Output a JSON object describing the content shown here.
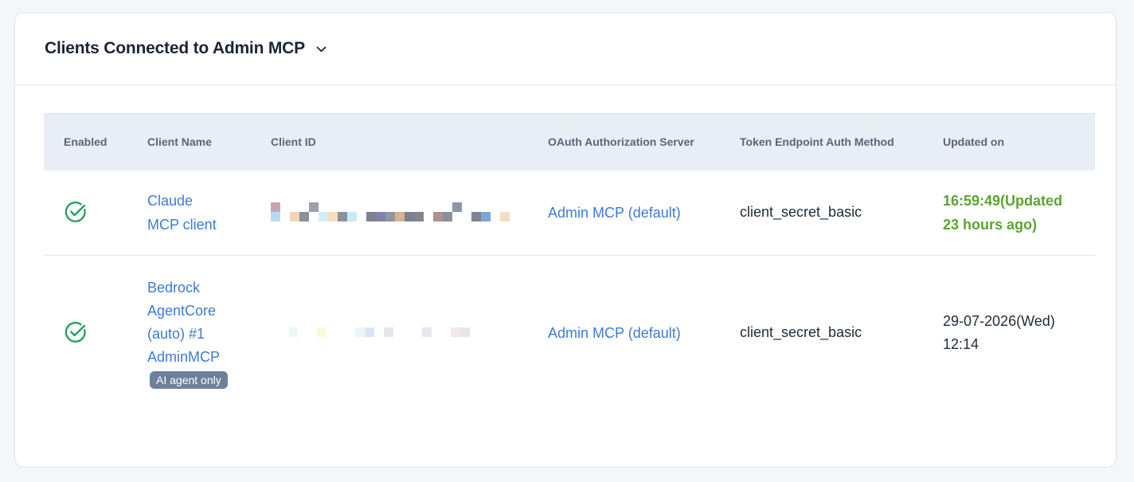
{
  "panel": {
    "title": "Clients Connected to Admin MCP",
    "icon": "chevron-down-icon"
  },
  "table": {
    "columns": [
      "Enabled",
      "Client Name",
      "Client ID",
      "OAuth Authorization Server",
      "Token Endpoint Auth Method",
      "Updated on"
    ],
    "rows": [
      {
        "enabled_icon": "check-circle-icon",
        "client_name_lines": [
          "Claude",
          "MCP client"
        ],
        "client_id_redacted": true,
        "auth_server": "Admin MCP (default)",
        "auth_method": "client_secret_basic",
        "updated_lines": [
          "16:59:49(Updated",
          "23 hours ago)"
        ]
      },
      {
        "enabled_icon": "check-circle-icon",
        "client_name_lines": [
          "Bedrock",
          "AgentCore",
          "(auto) #1",
          "AdminMCP"
        ],
        "badge": "AI agent only",
        "client_id_redacted": true,
        "auth_server": "Admin MCP (default)",
        "auth_method": "client_secret_basic",
        "updated_lines": [
          "29-07-2026(Wed)",
          "12:14"
        ]
      }
    ]
  },
  "colors": {
    "link": "#3a7bd5",
    "success": "#1e9e5a",
    "recent_update": "#5aa52f",
    "badge_bg": "#6e7f9a",
    "header_bg": "#e9eef6"
  }
}
